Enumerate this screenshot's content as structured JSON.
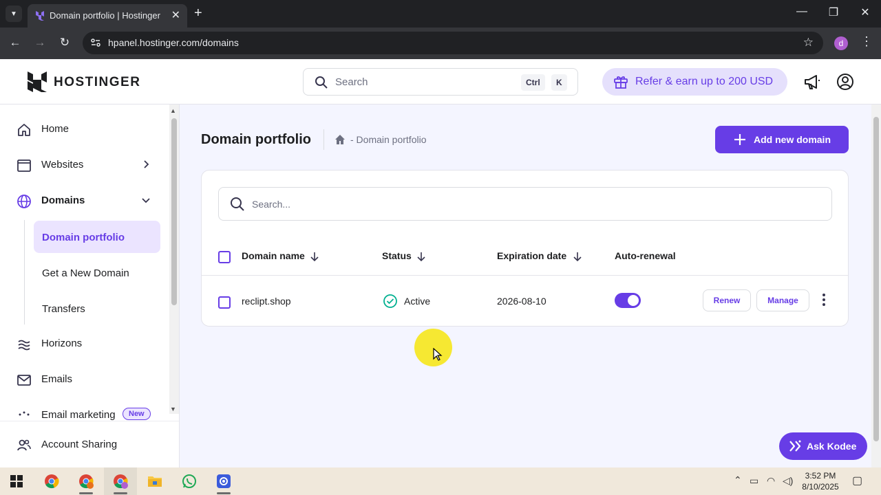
{
  "browser": {
    "tab_title": "Domain portfolio | Hostinger",
    "url": "hpanel.hostinger.com/domains",
    "profile_initial": "d"
  },
  "header": {
    "brand": "HOSTINGER",
    "search_placeholder": "Search",
    "shortcut_key1": "Ctrl",
    "shortcut_key2": "K",
    "refer_label": "Refer & earn up to 200 USD"
  },
  "sidebar": {
    "items": [
      {
        "label": "Home",
        "icon": "home-icon"
      },
      {
        "label": "Websites",
        "icon": "browser-window-icon"
      },
      {
        "label": "Domains",
        "icon": "globe-icon"
      },
      {
        "label": "Horizons",
        "icon": "waves-icon"
      },
      {
        "label": "Emails",
        "icon": "mail-icon"
      },
      {
        "label": "Email marketing",
        "icon": "sparkle-icon"
      },
      {
        "label": "Account Sharing",
        "icon": "users-icon"
      }
    ],
    "sub_items": [
      {
        "label": "Domain portfolio",
        "active": true
      },
      {
        "label": "Get a New Domain",
        "active": false
      },
      {
        "label": "Transfers",
        "active": false
      }
    ],
    "new_badge": "New"
  },
  "main": {
    "title": "Domain portfolio",
    "breadcrumb": "- Domain portfolio",
    "add_button": "Add new domain",
    "search_placeholder": "Search...",
    "columns": [
      "Domain name",
      "Status",
      "Expiration date",
      "Auto-renewal"
    ],
    "rows": [
      {
        "domain": "reclipt.shop",
        "status": "Active",
        "expiration": "2026-08-10",
        "auto_renewal": true
      }
    ],
    "renew_label": "Renew",
    "manage_label": "Manage"
  },
  "assistant": {
    "label": "Ask Kodee"
  },
  "taskbar": {
    "time": "3:52 PM",
    "date": "8/10/2025"
  },
  "colors": {
    "brand": "#673de6",
    "brand_light": "#ebe4ff",
    "status_green": "#00b090"
  }
}
